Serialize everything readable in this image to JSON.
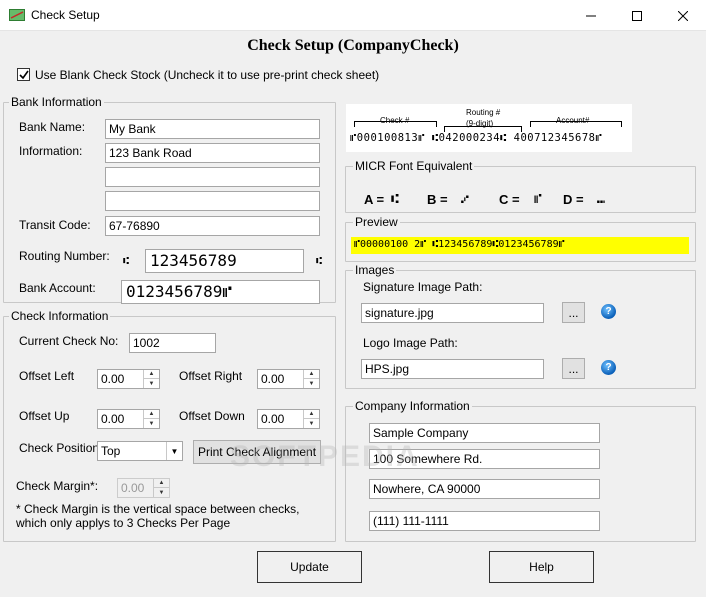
{
  "window": {
    "title": "Check Setup",
    "heading": "Check Setup (CompanyCheck)"
  },
  "blank_stock": {
    "checked": true,
    "label": "Use Blank Check Stock (Uncheck it to use pre-print check sheet)"
  },
  "bank": {
    "legend": "Bank Information",
    "name_label": "Bank Name:",
    "name_value": "My Bank",
    "info_label": "Information:",
    "info_line1": "123 Bank Road",
    "info_line2": "",
    "info_line3": "",
    "transit_label": "Transit Code:",
    "transit_value": "67-76890",
    "routing_label": "Routing Number:",
    "routing_value": "123456789",
    "account_label": "Bank Account:",
    "account_value": "0123456789⑈"
  },
  "check_info": {
    "legend": "Check Information",
    "current_label": "Current Check No:",
    "current_value": "1002",
    "offset_left_label": "Offset Left",
    "offset_left_value": "0.00",
    "offset_right_label": "Offset Right",
    "offset_right_value": "0.00",
    "offset_up_label": "Offset Up",
    "offset_up_value": "0.00",
    "offset_down_label": "Offset Down",
    "offset_down_value": "0.00",
    "position_label": "Check Position",
    "position_value": "Top",
    "print_alignment_label": "Print Check Alignment",
    "margin_label": "Check Margin*:",
    "margin_value": "0.00",
    "note": "* Check Margin is the vertical space between checks, which only applys to 3 Checks Per Page"
  },
  "micr_sample": {
    "check_label": "Check #",
    "routing_label": "Routing #",
    "routing_sub": "(9-digit)",
    "account_label": "Account#",
    "line": "⑈000100813⑈ ⑆042000234⑆ 400712345678⑈"
  },
  "micr_equiv": {
    "legend": "MICR Font Equivalent",
    "a_label": "A =",
    "a_symbol": "⑆",
    "b_label": "B =",
    "b_symbol": "⑇",
    "c_label": "C =",
    "c_symbol": "⑈",
    "d_label": "D =",
    "d_symbol": "⑉"
  },
  "preview": {
    "legend": "Preview",
    "line": "⑈00000100 2⑈ ⑆123456789⑆0123456789⑈"
  },
  "images": {
    "legend": "Images",
    "signature_label": "Signature Image Path:",
    "signature_value": "signature.jpg",
    "logo_label": "Logo Image Path:",
    "logo_value": "HPS.jpg",
    "browse_label": "..."
  },
  "company": {
    "legend": "Company Information",
    "line1": "Sample Company",
    "line2": "100 Somewhere Rd.",
    "line3": "Nowhere, CA 90000",
    "line4": "(111) 111-1111"
  },
  "buttons": {
    "update": "Update",
    "help": "Help"
  },
  "watermark": "SOFTPEDIA",
  "colors": {
    "preview_bg": "#ffff00",
    "help_icon": "#1a73c9"
  }
}
